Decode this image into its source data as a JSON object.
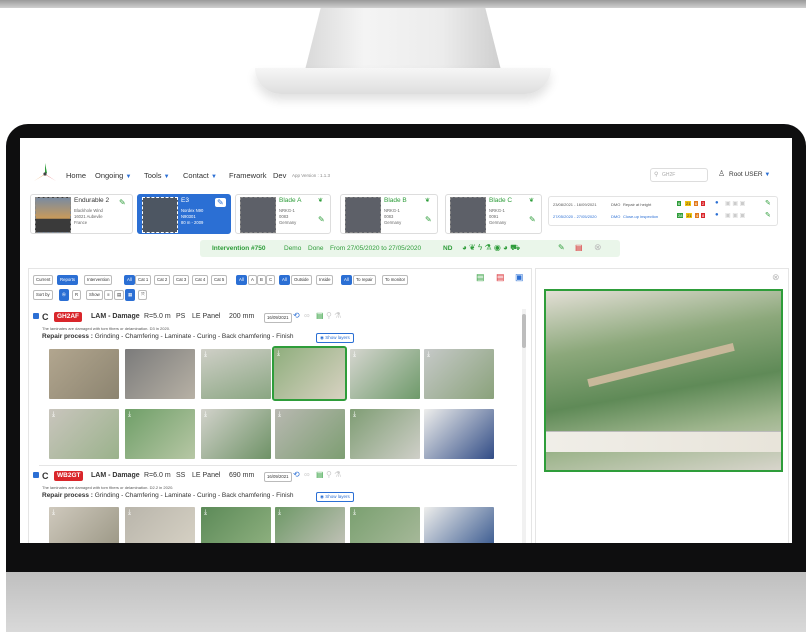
{
  "nav": {
    "home": "Home",
    "ongoing": "Ongoing",
    "tools": "Tools",
    "contact": "Contact",
    "framework": "Framework",
    "dev": "Dev",
    "version": "App Version : 1.1.3",
    "search_placeholder": "GH2F",
    "user": "Root USER"
  },
  "cards": [
    {
      "title": "Endurable 2",
      "l1": "Blackhole Wind",
      "l2": "16021 Aubevile",
      "l3": "France"
    },
    {
      "title": "E3",
      "l1": "Nordex N90",
      "l2": "N90301",
      "l3": "80 m - 2009"
    },
    {
      "title": "Blade A",
      "l1": "NRKG-1",
      "l2": "0083",
      "l3": "Germany"
    },
    {
      "title": "Blade B",
      "l1": "NRKG-1",
      "l2": "0083",
      "l3": "Germany"
    },
    {
      "title": "Blade C",
      "l1": "NRKG-1",
      "l2": "0091",
      "l3": "Germany"
    }
  ],
  "inspections": [
    {
      "dates": "23/08/2021 - 16/09/2021",
      "org": "DMO",
      "label": "Repair at height",
      "n": [
        "6",
        "21",
        "6",
        "2"
      ]
    },
    {
      "dates": "27/05/2020 - 27/05/2020",
      "org": "DMO",
      "label": "Close-up inspection",
      "n": [
        "28",
        "21",
        "4",
        "8"
      ]
    }
  ],
  "intervention": {
    "title": "Intervention #750",
    "type": "Demo",
    "status": "Done",
    "period": "From 27/05/2020 to 27/05/2020",
    "code": "ND"
  },
  "filters": {
    "views": [
      "Current",
      "Reports",
      "Intervention"
    ],
    "cats": [
      "All",
      "Cat 1",
      "Cat 2",
      "Cat 3",
      "Cat 4",
      "Cat 5"
    ],
    "blades": [
      "All",
      "A",
      "B",
      "C"
    ],
    "sides": [
      "All",
      "Outside",
      "Inside"
    ],
    "repair": [
      "All",
      "To repair",
      "To monitor"
    ],
    "sortby": "Sort by",
    "r": "R",
    "show": "Show"
  },
  "damages": [
    {
      "grade": "C",
      "tag": "GH2AF",
      "kind": "LAM - Damage",
      "r": "R=5.0 m",
      "side": "PS",
      "zone": "LE Panel",
      "size": "200 mm",
      "date": "16/09/2021",
      "desc": "The laminates are damaged with torn fibers or delamination. D3 in 2020.",
      "process_label": "Repair process :",
      "process": "Grinding - Chamfering - Laminate - Curing - Back chamfering - Finish",
      "layers": "Show layers"
    },
    {
      "grade": "C",
      "tag": "WB2GT",
      "kind": "LAM - Damage",
      "r": "R=6.0 m",
      "side": "SS",
      "zone": "LE Panel",
      "size": "690 mm",
      "date": "16/09/2021",
      "desc": "The laminates are damaged with torn fibers or delamination. D2.2 in 2020.",
      "process_label": "Repair process :",
      "process": "Grinding - Chamfering - Laminate - Curing - Back chamfering - Finish",
      "layers": "Show layers"
    }
  ],
  "colors": {
    "accent": "#2b6fd4",
    "green": "#2e9d3a",
    "red": "#d9262b",
    "bezel": "#0e0e0f"
  }
}
